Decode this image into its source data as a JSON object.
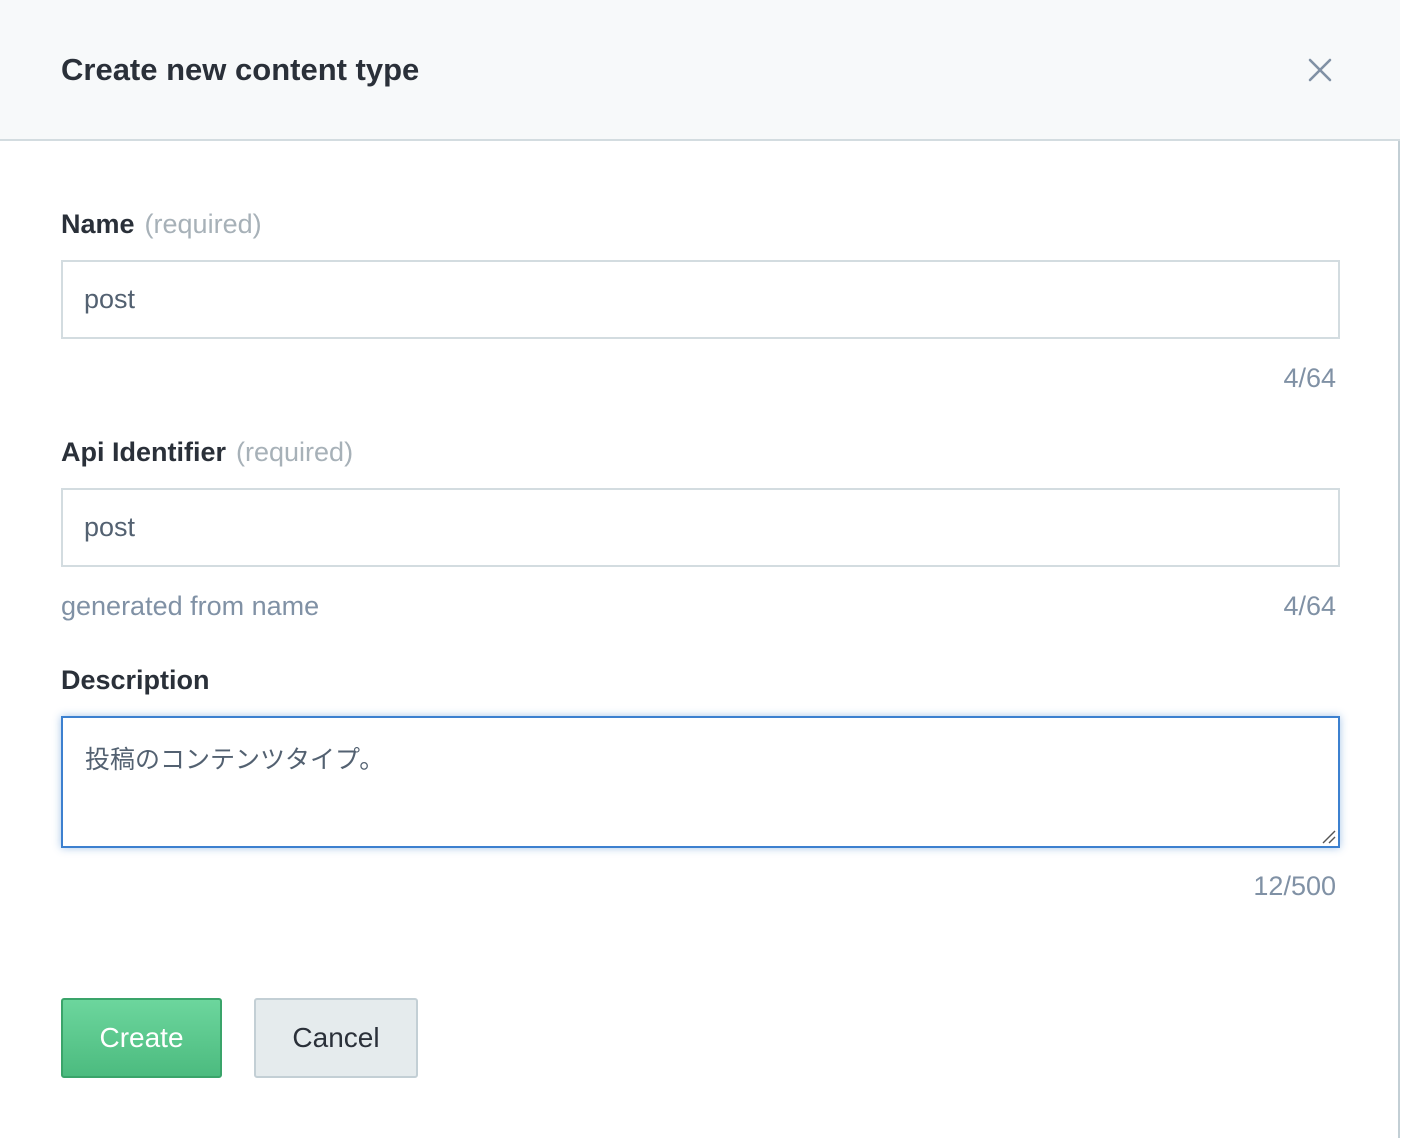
{
  "modal": {
    "title": "Create new content type",
    "close_icon": "close-icon"
  },
  "fields": {
    "name": {
      "label": "Name",
      "required_text": "(required)",
      "value": "post",
      "counter": "4/64"
    },
    "api_identifier": {
      "label": "Api Identifier",
      "required_text": "(required)",
      "value": "post",
      "hint": "generated from name",
      "counter": "4/64"
    },
    "description": {
      "label": "Description",
      "value": "投稿のコンテンツタイプ。",
      "counter": "12/500"
    }
  },
  "actions": {
    "create_label": "Create",
    "cancel_label": "Cancel"
  },
  "colors": {
    "primary_green": "#52c188",
    "focus_blue": "#3c80cf",
    "muted_text": "#8091a5",
    "heading_text": "#2a3039"
  }
}
